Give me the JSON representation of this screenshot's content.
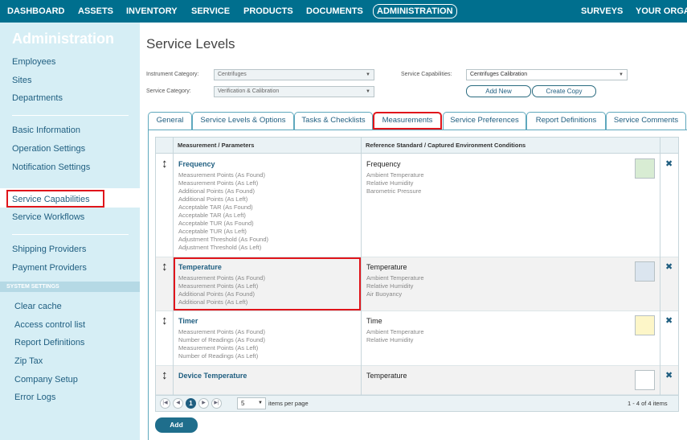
{
  "nav": {
    "items": [
      "DASHBOARD",
      "ASSETS",
      "INVENTORY",
      "SERVICE",
      "PRODUCTS",
      "DOCUMENTS",
      "ADMINISTRATION",
      "SURVEYS",
      "YOUR ORGAN"
    ],
    "active": "ADMINISTRATION"
  },
  "sidebar": {
    "title": "Administration",
    "group1": [
      "Employees",
      "Sites",
      "Departments"
    ],
    "group2": [
      "Basic Information",
      "Operation Settings",
      "Notification Settings",
      "Service Capabilities",
      "Service Workflows"
    ],
    "group3": [
      "Shipping Providers",
      "Payment Providers"
    ],
    "system_header": "SYSTEM SETTINGS",
    "system": [
      "Clear cache",
      "Access control list",
      "Report Definitions",
      "Zip Tax",
      "Company Setup",
      "Error Logs"
    ],
    "active": "Service Capabilities"
  },
  "page": {
    "title": "Service Levels",
    "instrument_category_label": "Instrument Category:",
    "instrument_category_value": "Centrifuges",
    "service_category_label": "Service Category:",
    "service_category_value": "Verification & Calibration",
    "service_capabilities_label": "Service Capabilities:",
    "service_capabilities_value": "Centrifuges Calibration",
    "add_new": "Add New",
    "create_copy": "Create Copy"
  },
  "tabs": [
    "General",
    "Service Levels & Options",
    "Tasks & Checklists",
    "Measurements",
    "Service Preferences",
    "Report Definitions",
    "Service Comments"
  ],
  "active_tab": "Measurements",
  "table": {
    "col1": "Measurement / Parameters",
    "col2": "Reference Standard / Captured Environment Conditions",
    "rows": [
      {
        "name": "Frequency",
        "params": [
          "Measurement Points (As Found)",
          "Measurement Points (As Left)",
          "Additional Points (As Found)",
          "Additional Points (As Left)",
          "Acceptable TAR (As Found)",
          "Acceptable TAR (As Left)",
          "Acceptable TUR (As Found)",
          "Acceptable TUR (As Left)",
          "Adjustment Threshold (As Found)",
          "Adjustment Threshold (As Left)"
        ],
        "ref": "Frequency",
        "conditions": [
          "Ambient Temperature",
          "Relative Humidity",
          "Barometric Pressure"
        ],
        "color": "#d8ecd3"
      },
      {
        "name": "Temperature",
        "params": [
          "Measurement Points (As Found)",
          "Measurement Points (As Left)",
          "Additional Points (As Found)",
          "Additional Points (As Left)"
        ],
        "ref": "Temperature",
        "conditions": [
          "Ambient Temperature",
          "Relative Humidity",
          "Air Buoyancy"
        ],
        "color": "#dbe5ef"
      },
      {
        "name": "Timer",
        "params": [
          "Measurement Points (As Found)",
          "Number of Readings (As Found)",
          "Measurement Points (As Left)",
          "Number of Readings (As Left)"
        ],
        "ref": "Time",
        "conditions": [
          "Ambient Temperature",
          "Relative Humidity"
        ],
        "color": "#fdf6c8"
      },
      {
        "name": "Device Temperature",
        "params": [],
        "ref": "Temperature",
        "conditions": [],
        "color": "#ffffff"
      }
    ]
  },
  "pager": {
    "current_page": "1",
    "page_size": "5",
    "per_page_label": "items per page",
    "summary": "1 - 4 of 4 items"
  },
  "add_button": "Add"
}
